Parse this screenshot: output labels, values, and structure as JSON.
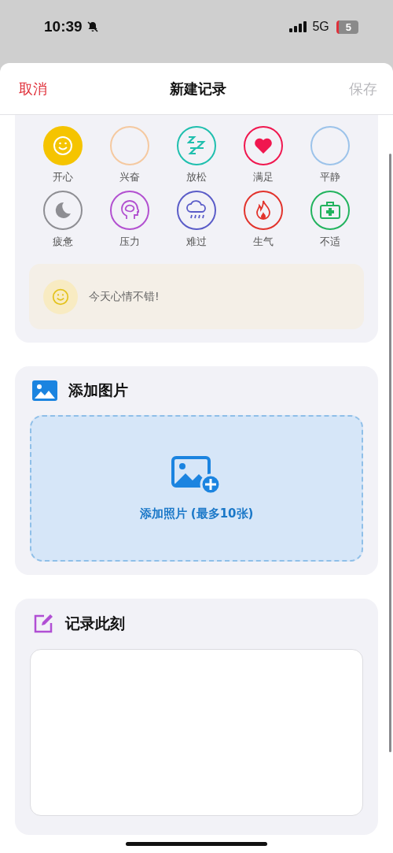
{
  "status_bar": {
    "time": "10:39",
    "network": "5G",
    "battery": "5"
  },
  "nav": {
    "cancel": "取消",
    "title": "新建记录",
    "save": "保存",
    "save_disabled": true
  },
  "moods": [
    {
      "label": "开心",
      "kind": "smile",
      "color": "#f5c400",
      "selected": true
    },
    {
      "label": "兴奋",
      "kind": "blank",
      "color": "#f5c9a0",
      "selected": false
    },
    {
      "label": "放松",
      "kind": "zzz",
      "color": "#1fbfae",
      "selected": false
    },
    {
      "label": "满足",
      "kind": "heart",
      "color": "#f0174f",
      "selected": false
    },
    {
      "label": "平静",
      "kind": "blank",
      "color": "#9cc3ea",
      "selected": false
    },
    {
      "label": "疲惫",
      "kind": "moon",
      "color": "#8e8e93",
      "selected": false
    },
    {
      "label": "压力",
      "kind": "brain",
      "color": "#b250d0",
      "selected": false
    },
    {
      "label": "难过",
      "kind": "rain",
      "color": "#5a5cc8",
      "selected": false
    },
    {
      "label": "生气",
      "kind": "fire",
      "color": "#e2332c",
      "selected": false
    },
    {
      "label": "不适",
      "kind": "medkit",
      "color": "#22b35e",
      "selected": false
    }
  ],
  "mood_hint": "今天心情不错!",
  "photos": {
    "title": "添加图片",
    "add_label": "添加照片 (最多10张)"
  },
  "note": {
    "title": "记录此刻"
  }
}
